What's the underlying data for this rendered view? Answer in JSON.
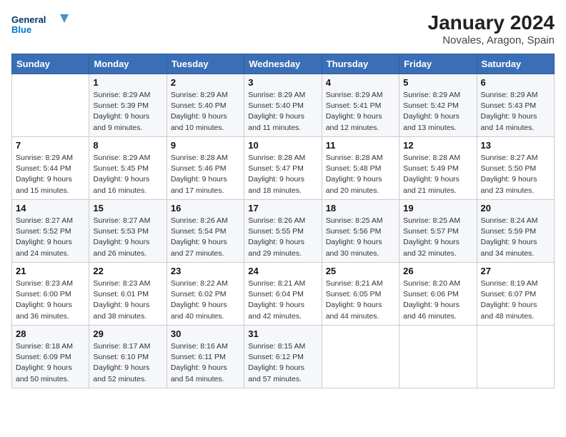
{
  "header": {
    "logo_line1": "General",
    "logo_line2": "Blue",
    "month_year": "January 2024",
    "location": "Novales, Aragon, Spain"
  },
  "days_of_week": [
    "Sunday",
    "Monday",
    "Tuesday",
    "Wednesday",
    "Thursday",
    "Friday",
    "Saturday"
  ],
  "weeks": [
    [
      {
        "day": "",
        "sunrise": "",
        "sunset": "",
        "daylight": ""
      },
      {
        "day": "1",
        "sunrise": "Sunrise: 8:29 AM",
        "sunset": "Sunset: 5:39 PM",
        "daylight": "Daylight: 9 hours and 9 minutes."
      },
      {
        "day": "2",
        "sunrise": "Sunrise: 8:29 AM",
        "sunset": "Sunset: 5:40 PM",
        "daylight": "Daylight: 9 hours and 10 minutes."
      },
      {
        "day": "3",
        "sunrise": "Sunrise: 8:29 AM",
        "sunset": "Sunset: 5:40 PM",
        "daylight": "Daylight: 9 hours and 11 minutes."
      },
      {
        "day": "4",
        "sunrise": "Sunrise: 8:29 AM",
        "sunset": "Sunset: 5:41 PM",
        "daylight": "Daylight: 9 hours and 12 minutes."
      },
      {
        "day": "5",
        "sunrise": "Sunrise: 8:29 AM",
        "sunset": "Sunset: 5:42 PM",
        "daylight": "Daylight: 9 hours and 13 minutes."
      },
      {
        "day": "6",
        "sunrise": "Sunrise: 8:29 AM",
        "sunset": "Sunset: 5:43 PM",
        "daylight": "Daylight: 9 hours and 14 minutes."
      }
    ],
    [
      {
        "day": "7",
        "sunrise": "Sunrise: 8:29 AM",
        "sunset": "Sunset: 5:44 PM",
        "daylight": "Daylight: 9 hours and 15 minutes."
      },
      {
        "day": "8",
        "sunrise": "Sunrise: 8:29 AM",
        "sunset": "Sunset: 5:45 PM",
        "daylight": "Daylight: 9 hours and 16 minutes."
      },
      {
        "day": "9",
        "sunrise": "Sunrise: 8:28 AM",
        "sunset": "Sunset: 5:46 PM",
        "daylight": "Daylight: 9 hours and 17 minutes."
      },
      {
        "day": "10",
        "sunrise": "Sunrise: 8:28 AM",
        "sunset": "Sunset: 5:47 PM",
        "daylight": "Daylight: 9 hours and 18 minutes."
      },
      {
        "day": "11",
        "sunrise": "Sunrise: 8:28 AM",
        "sunset": "Sunset: 5:48 PM",
        "daylight": "Daylight: 9 hours and 20 minutes."
      },
      {
        "day": "12",
        "sunrise": "Sunrise: 8:28 AM",
        "sunset": "Sunset: 5:49 PM",
        "daylight": "Daylight: 9 hours and 21 minutes."
      },
      {
        "day": "13",
        "sunrise": "Sunrise: 8:27 AM",
        "sunset": "Sunset: 5:50 PM",
        "daylight": "Daylight: 9 hours and 23 minutes."
      }
    ],
    [
      {
        "day": "14",
        "sunrise": "Sunrise: 8:27 AM",
        "sunset": "Sunset: 5:52 PM",
        "daylight": "Daylight: 9 hours and 24 minutes."
      },
      {
        "day": "15",
        "sunrise": "Sunrise: 8:27 AM",
        "sunset": "Sunset: 5:53 PM",
        "daylight": "Daylight: 9 hours and 26 minutes."
      },
      {
        "day": "16",
        "sunrise": "Sunrise: 8:26 AM",
        "sunset": "Sunset: 5:54 PM",
        "daylight": "Daylight: 9 hours and 27 minutes."
      },
      {
        "day": "17",
        "sunrise": "Sunrise: 8:26 AM",
        "sunset": "Sunset: 5:55 PM",
        "daylight": "Daylight: 9 hours and 29 minutes."
      },
      {
        "day": "18",
        "sunrise": "Sunrise: 8:25 AM",
        "sunset": "Sunset: 5:56 PM",
        "daylight": "Daylight: 9 hours and 30 minutes."
      },
      {
        "day": "19",
        "sunrise": "Sunrise: 8:25 AM",
        "sunset": "Sunset: 5:57 PM",
        "daylight": "Daylight: 9 hours and 32 minutes."
      },
      {
        "day": "20",
        "sunrise": "Sunrise: 8:24 AM",
        "sunset": "Sunset: 5:59 PM",
        "daylight": "Daylight: 9 hours and 34 minutes."
      }
    ],
    [
      {
        "day": "21",
        "sunrise": "Sunrise: 8:23 AM",
        "sunset": "Sunset: 6:00 PM",
        "daylight": "Daylight: 9 hours and 36 minutes."
      },
      {
        "day": "22",
        "sunrise": "Sunrise: 8:23 AM",
        "sunset": "Sunset: 6:01 PM",
        "daylight": "Daylight: 9 hours and 38 minutes."
      },
      {
        "day": "23",
        "sunrise": "Sunrise: 8:22 AM",
        "sunset": "Sunset: 6:02 PM",
        "daylight": "Daylight: 9 hours and 40 minutes."
      },
      {
        "day": "24",
        "sunrise": "Sunrise: 8:21 AM",
        "sunset": "Sunset: 6:04 PM",
        "daylight": "Daylight: 9 hours and 42 minutes."
      },
      {
        "day": "25",
        "sunrise": "Sunrise: 8:21 AM",
        "sunset": "Sunset: 6:05 PM",
        "daylight": "Daylight: 9 hours and 44 minutes."
      },
      {
        "day": "26",
        "sunrise": "Sunrise: 8:20 AM",
        "sunset": "Sunset: 6:06 PM",
        "daylight": "Daylight: 9 hours and 46 minutes."
      },
      {
        "day": "27",
        "sunrise": "Sunrise: 8:19 AM",
        "sunset": "Sunset: 6:07 PM",
        "daylight": "Daylight: 9 hours and 48 minutes."
      }
    ],
    [
      {
        "day": "28",
        "sunrise": "Sunrise: 8:18 AM",
        "sunset": "Sunset: 6:09 PM",
        "daylight": "Daylight: 9 hours and 50 minutes."
      },
      {
        "day": "29",
        "sunrise": "Sunrise: 8:17 AM",
        "sunset": "Sunset: 6:10 PM",
        "daylight": "Daylight: 9 hours and 52 minutes."
      },
      {
        "day": "30",
        "sunrise": "Sunrise: 8:16 AM",
        "sunset": "Sunset: 6:11 PM",
        "daylight": "Daylight: 9 hours and 54 minutes."
      },
      {
        "day": "31",
        "sunrise": "Sunrise: 8:15 AM",
        "sunset": "Sunset: 6:12 PM",
        "daylight": "Daylight: 9 hours and 57 minutes."
      },
      {
        "day": "",
        "sunrise": "",
        "sunset": "",
        "daylight": ""
      },
      {
        "day": "",
        "sunrise": "",
        "sunset": "",
        "daylight": ""
      },
      {
        "day": "",
        "sunrise": "",
        "sunset": "",
        "daylight": ""
      }
    ]
  ]
}
